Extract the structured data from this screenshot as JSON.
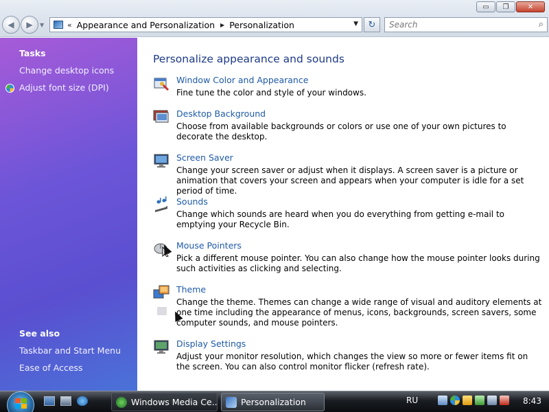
{
  "window": {
    "controls": {
      "minimize": "▭",
      "maximize": "❐",
      "close": "✕"
    }
  },
  "nav": {
    "back": "◀",
    "forward": "▶",
    "dropdown": "▼"
  },
  "address": {
    "chevron": "«",
    "crumbs": [
      "Appearance and Personalization",
      "Personalization"
    ],
    "separator": "▶",
    "dropdown": "▼",
    "refresh": "↻"
  },
  "search": {
    "placeholder": "Search",
    "icon": "⌕"
  },
  "sidebar": {
    "tasks_heading": "Tasks",
    "tasks": [
      {
        "label": "Change desktop icons"
      },
      {
        "label": "Adjust font size (DPI)",
        "icon": "shield-icon"
      }
    ],
    "see_also_heading": "See also",
    "see_also": [
      {
        "label": "Taskbar and Start Menu"
      },
      {
        "label": "Ease of Access"
      }
    ]
  },
  "main": {
    "title": "Personalize appearance and sounds",
    "items": [
      {
        "title": "Window Color and Appearance",
        "desc": "Fine tune the color and style of your windows.",
        "icon": "window-color-icon"
      },
      {
        "title": "Desktop Background",
        "desc": "Choose from available backgrounds or colors or use one of your own pictures to decorate the desktop.",
        "icon": "desktop-background-icon"
      },
      {
        "title": "Screen Saver",
        "desc": "Change your screen saver or adjust when it displays. A screen saver is a picture or animation that covers your screen and appears when your computer is idle for a set period of time.",
        "icon": "screen-saver-icon"
      },
      {
        "title": "Sounds",
        "desc": "Change which sounds are heard when you do everything from getting e-mail to emptying your Recycle Bin.",
        "icon": "sounds-icon"
      },
      {
        "title": "Mouse Pointers",
        "desc": "Pick a different mouse pointer. You can also change how the mouse pointer looks during such activities as clicking and selecting.",
        "icon": "mouse-pointers-icon"
      },
      {
        "title": "Theme",
        "desc": "Change the theme. Themes can change a wide range of visual and auditory elements at one time including the appearance of menus, icons, backgrounds, screen savers, some computer sounds, and mouse pointers.",
        "icon": "theme-icon"
      },
      {
        "title": "Display Settings",
        "desc": "Adjust your monitor resolution, which changes the view so more or fewer items fit on the screen. You can also control monitor flicker (refresh rate).",
        "icon": "display-settings-icon"
      }
    ]
  },
  "taskbar": {
    "tasks": [
      {
        "label": "Windows Media Ce...",
        "icon": "media-center-icon",
        "active": false
      },
      {
        "label": "Personalization",
        "icon": "personalization-icon",
        "active": true
      }
    ],
    "language": "RU",
    "clock": "8:43"
  },
  "colors": {
    "link": "#1e5aa8",
    "title": "#1c3a87",
    "sidebar_top": "#a75bd8",
    "sidebar_bottom": "#4a72d8"
  }
}
